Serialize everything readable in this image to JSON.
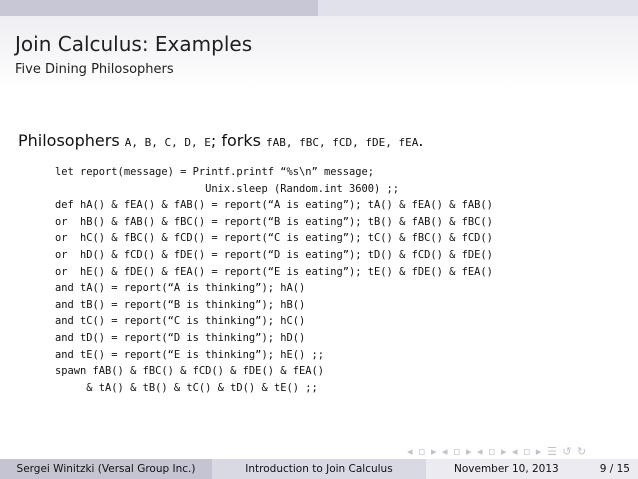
{
  "frame": {
    "title": "Join Calculus: Examples",
    "subtitle": "Five Dining Philosophers"
  },
  "heading": {
    "philosophers_word": "Philosophers",
    "philosophers_list": "A, B, C, D, E",
    "forks_sep": "; forks",
    "forks_list": "fAB, fBC, fCD, fDE, fEA",
    "end": "."
  },
  "code": {
    "lines": [
      "let report(message) = Printf.printf “%s\\n” message;",
      "                        Unix.sleep (Random.int 3600) ;;",
      "def hA() & fEA() & fAB() = report(“A is eating”); tA() & fEA() & fAB()",
      "or  hB() & fAB() & fBC() = report(“B is eating”); tB() & fAB() & fBC()",
      "or  hC() & fBC() & fCD() = report(“C is eating”); tC() & fBC() & fCD()",
      "or  hD() & fCD() & fDE() = report(“D is eating”); tD() & fCD() & fDE()",
      "or  hE() & fDE() & fEA() = report(“E is eating”); tE() & fDE() & fEA()",
      "and tA() = report(“A is thinking”); hA()",
      "and tB() = report(“B is thinking”); hB()",
      "and tC() = report(“C is thinking”); hC()",
      "and tD() = report(“D is thinking”); hD()",
      "and tE() = report(“E is thinking”); hE() ;;",
      "spawn fAB() & fBC() & fCD() & fDE() & fEA()",
      "     & tA() & tB() & tC() & tD() & tE() ;;"
    ]
  },
  "nav": {
    "symbols": "◂ ▫ ▸ ◂ ▫ ▸ ◂ ▫ ▸ ◂ ▫ ▸ ☰ ↺ ↻"
  },
  "footer": {
    "author": "Sergei Winitzki (Versal Group Inc.)",
    "talk_title": "Introduction to Join Calculus",
    "date": "November 10, 2013",
    "page": "9 / 15"
  }
}
